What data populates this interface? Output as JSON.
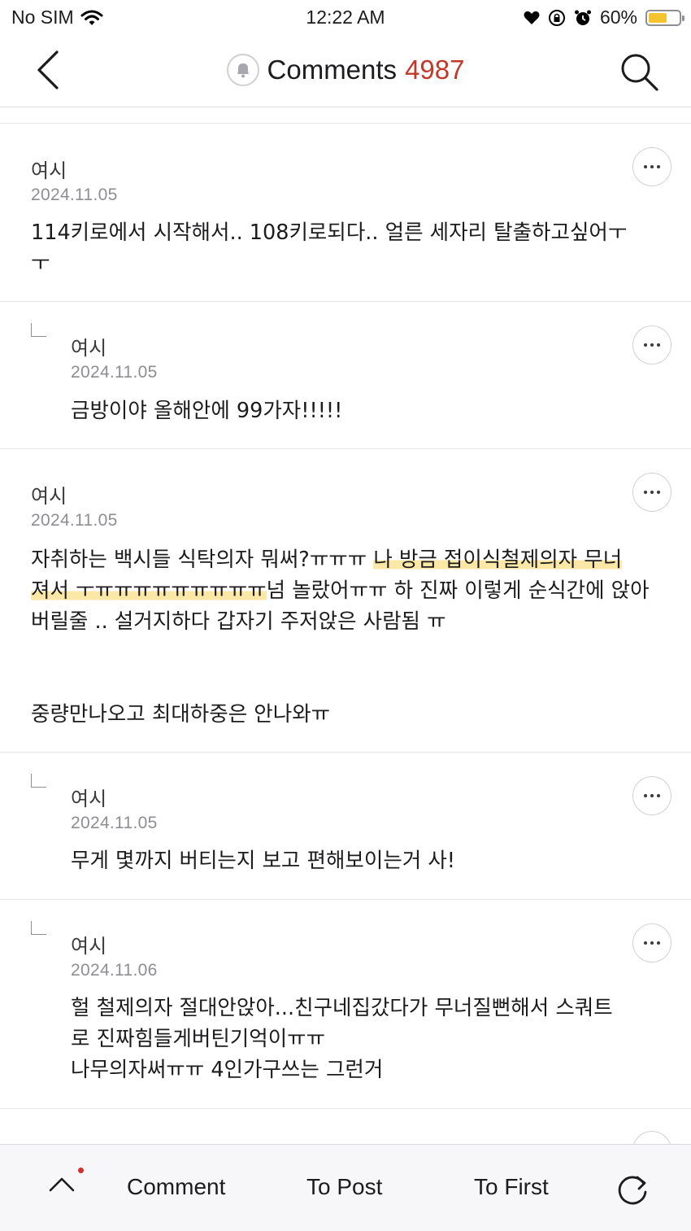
{
  "status_bar": {
    "carrier": "No SIM",
    "time": "12:22 AM",
    "battery": "60%",
    "battery_level": 0.6
  },
  "nav": {
    "title": "Comments",
    "count": "4987"
  },
  "comments": [
    {
      "author": "여시",
      "date": "2024.11.05",
      "reply": false,
      "text": "114키로에서 시작해서.. 108키로되다.. 얼른 세자리 탈출하고싶어ㅜ\nㅜ"
    },
    {
      "author": "여시",
      "date": "2024.11.05",
      "reply": true,
      "text": "금방이야 올해안에 99가자!!!!!"
    },
    {
      "author": "여시",
      "date": "2024.11.05",
      "reply": false,
      "text_a": "자취하는 백시들 식탁의자 뭐써?ㅠㅠㅠ ",
      "text_hl1": "나 방금 접이식철제의자 무너",
      "text_hl2": "져서 ㅜㅠㅠㅠㅠㅠㅠㅠㅠㅠ",
      "text_b": "넘 놀랐어ㅠㅠ 하 진짜 이렇게 순식간에 앉아\n버릴줄 .. 설거지하다 갑자기 주저앉은 사람됨 ㅠ\n\n\n중량만나오고 최대하중은 안나와ㅠ"
    },
    {
      "author": "여시",
      "date": "2024.11.05",
      "reply": true,
      "text": "무게 몇까지 버티는지 보고 편해보이는거 사!"
    },
    {
      "author": "여시",
      "date": "2024.11.06",
      "reply": true,
      "text": "헐 철제의자 절대안앉아...친구네집갔다가 무너질뻔해서 스쿼트\n로 진짜힘들게버틴기억이ㅠㅠ\n나무의자써ㅠㅠ 4인가구쓰는 그런거"
    }
  ],
  "bottom_bar": {
    "comment": "Comment",
    "to_post": "To Post",
    "to_first": "To First"
  },
  "icons": [
    "wifi-icon",
    "heart-icon",
    "lock-rotation-icon",
    "alarm-icon",
    "battery-icon",
    "back-chevron-icon",
    "bell-icon",
    "search-icon",
    "more-icon",
    "reply-arrow-icon",
    "chevron-up-icon",
    "refresh-icon"
  ],
  "colors": {
    "count": "#c1392b",
    "highlight": "#fbe7a6",
    "notification_dot": "#d0312d",
    "battery_fill": "#f4c430"
  }
}
